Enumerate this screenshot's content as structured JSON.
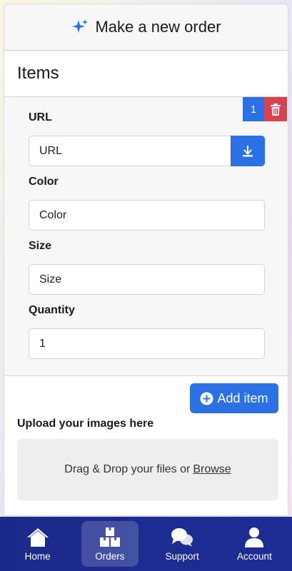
{
  "header": {
    "title": "Make a new order",
    "icon": "sparkle-icon"
  },
  "items_section": {
    "heading": "Items",
    "item_number": "1"
  },
  "form": {
    "url_label": "URL",
    "url_placeholder": "URL",
    "color_label": "Color",
    "color_placeholder": "Color",
    "size_label": "Size",
    "size_placeholder": "Size",
    "quantity_label": "Quantity",
    "quantity_value": "1"
  },
  "actions": {
    "add_item_label": "Add item"
  },
  "upload": {
    "title": "Upload your images here",
    "drop_text": "Drag & Drop your files or",
    "browse_label": "Browse"
  },
  "nav": {
    "items": [
      {
        "label": "Home",
        "icon": "home-icon"
      },
      {
        "label": "Orders",
        "icon": "boxes-icon",
        "active": true
      },
      {
        "label": "Support",
        "icon": "chat-icon"
      },
      {
        "label": "Account",
        "icon": "user-icon"
      }
    ]
  },
  "colors": {
    "primary": "#2b70e4",
    "danger": "#d9414d",
    "nav": "#1b2a8a"
  }
}
